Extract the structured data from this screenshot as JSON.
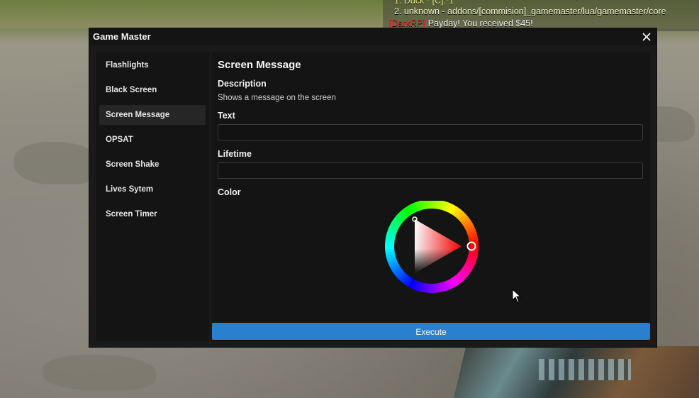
{
  "console": {
    "line1": "1. Duck - [C]:-1",
    "line2": "2. unknown - addons/[commision]_gamemaster/lua/gamemaster/core",
    "chat_tag": "[DarkRP]",
    "chat_message": "Payday! You received $45!"
  },
  "window": {
    "title": "Game Master",
    "close_icon": "close-icon"
  },
  "sidebar": {
    "items": [
      {
        "label": "Flashlights",
        "active": false
      },
      {
        "label": "Black Screen",
        "active": false
      },
      {
        "label": "Screen Message",
        "active": true
      },
      {
        "label": "OPSAT",
        "active": false
      },
      {
        "label": "Screen Shake",
        "active": false
      },
      {
        "label": "Lives Sytem",
        "active": false
      },
      {
        "label": "Screen Timer",
        "active": false
      }
    ]
  },
  "panel": {
    "title": "Screen Message",
    "description_label": "Description",
    "description": "Shows a message on the screen",
    "text_label": "Text",
    "text_value": "",
    "lifetime_label": "Lifetime",
    "lifetime_value": "",
    "color_label": "Color",
    "selected_hue": "#ff0000"
  },
  "execute_button": {
    "label": "Execute",
    "color": "#2b7fcf"
  },
  "colors": {
    "window_bg": "#1a1a1a",
    "panel_bg": "#141414",
    "active_item": "#262626",
    "chat_tag": "#e32a2a",
    "console_text": "#e6e37a"
  }
}
